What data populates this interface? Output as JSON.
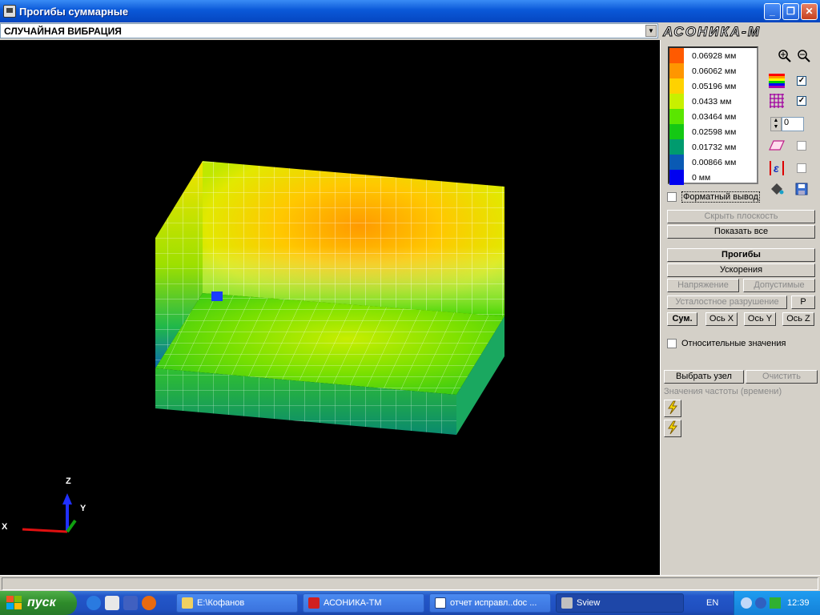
{
  "window": {
    "title": "Прогибы суммарные",
    "controls": [
      "_",
      "❐",
      "✕"
    ]
  },
  "analysis_select": {
    "value": "СЛУЧАЙНАЯ ВИБРАЦИЯ"
  },
  "logo": {
    "text": "АСОНИКА-М"
  },
  "legend": [
    {
      "label": "0.06928 мм",
      "color": "#ff5a00"
    },
    {
      "label": "0.06062 мм",
      "color": "#ff9600"
    },
    {
      "label": "0.05196 мм",
      "color": "#ffd200"
    },
    {
      "label": "0.0433 мм",
      "color": "#c8f000"
    },
    {
      "label": "0.03464 мм",
      "color": "#5ae600"
    },
    {
      "label": "0.02598 мм",
      "color": "#14c814"
    },
    {
      "label": "0.01732 мм",
      "color": "#009b6e"
    },
    {
      "label": "0.00866 мм",
      "color": "#0a5ab4"
    },
    {
      "label": "0 мм",
      "color": "#0000f0"
    }
  ],
  "tools": {
    "spin_value": "0",
    "check_palette": "✓",
    "check_grid": "✓"
  },
  "format_output": {
    "label": "Форматный вывод"
  },
  "buttons": {
    "hide_plane": "Скрыть плоскость",
    "show_all": "Показать все",
    "deflections": "Прогибы",
    "accelerations": "Ускорения",
    "stress": "Напряжение",
    "allowable": "Допустимые",
    "fatigue": "Усталостное разрушение",
    "p": "Р",
    "sum": "Сум.",
    "axis_x": "Ось X",
    "axis_y": "Ось Y",
    "axis_z": "Ось Z",
    "select_node": "Выбрать узел",
    "clear": "Очистить"
  },
  "relative_values": {
    "label": "Относительные значения"
  },
  "freq_values": {
    "label": "Значения частоты (времени)"
  },
  "axes": {
    "x": "X",
    "y": "Y",
    "z": "Z"
  },
  "taskbar": {
    "start": "пуск",
    "tasks": [
      "E:\\Кофанов",
      "АСОНИКА-ТМ",
      "отчет исправл..doc ...",
      "Sview"
    ],
    "lang": "EN",
    "clock": "12:39"
  }
}
